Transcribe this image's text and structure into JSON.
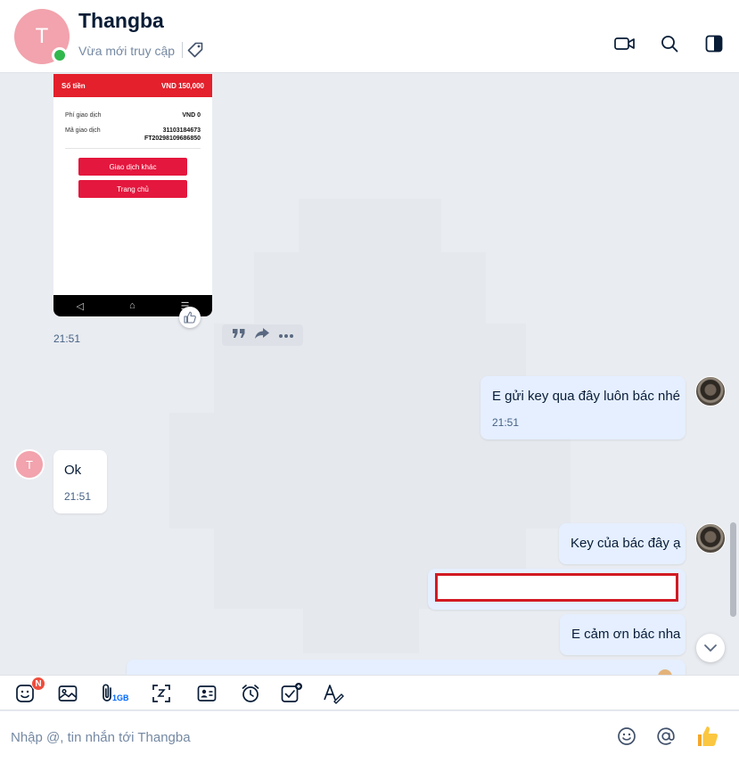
{
  "colors": {
    "accent": "#0068ff",
    "online": "#30b84d",
    "avatar_bg": "#f2a3ad",
    "my_bubble": "#e5efff",
    "badge": "#ef4d3c"
  },
  "header": {
    "avatar_initial": "T",
    "title": "Thangba",
    "status": "Vừa mới truy cập",
    "icons": [
      "tag-icon",
      "video-call-icon",
      "search-icon",
      "sidebar-toggle-icon"
    ]
  },
  "image_message": {
    "amount_label": "Số tiền",
    "amount_value": "VND  150,000",
    "fee_label": "Phí giao dịch",
    "fee_value": "VND 0",
    "txn_label": "Mã giao dịch",
    "txn_value_1": "31103184673",
    "txn_value_2": "FT20298109686850",
    "btn_other": "Giao dịch khác",
    "btn_home": "Trang chủ",
    "nav_back": "◁",
    "nav_home": "⌂",
    "nav_menu": "☰",
    "time": "21:51"
  },
  "messages": [
    {
      "from": "me",
      "text": "E gửi key qua đây luôn bác nhé",
      "time": "21:51"
    },
    {
      "from": "them",
      "text": "Ok",
      "time": "21:51",
      "avatar_initial": "T"
    },
    {
      "from": "me",
      "text": "Key của bác đây ạ"
    },
    {
      "from": "me",
      "text": "E cảm ơn bác nha"
    }
  ],
  "toolbar": {
    "badge": "N",
    "attach_limit": "1GB",
    "icons": [
      "sticker-icon",
      "image-icon",
      "attach-icon",
      "screenshot-icon",
      "contact-card-icon",
      "reminder-icon",
      "todo-icon",
      "format-text-icon"
    ]
  },
  "composer": {
    "placeholder": "Nhập @, tin nhắn tới Thangba",
    "icons": [
      "emoji-icon",
      "mention-icon",
      "thumbs-up-icon"
    ]
  }
}
